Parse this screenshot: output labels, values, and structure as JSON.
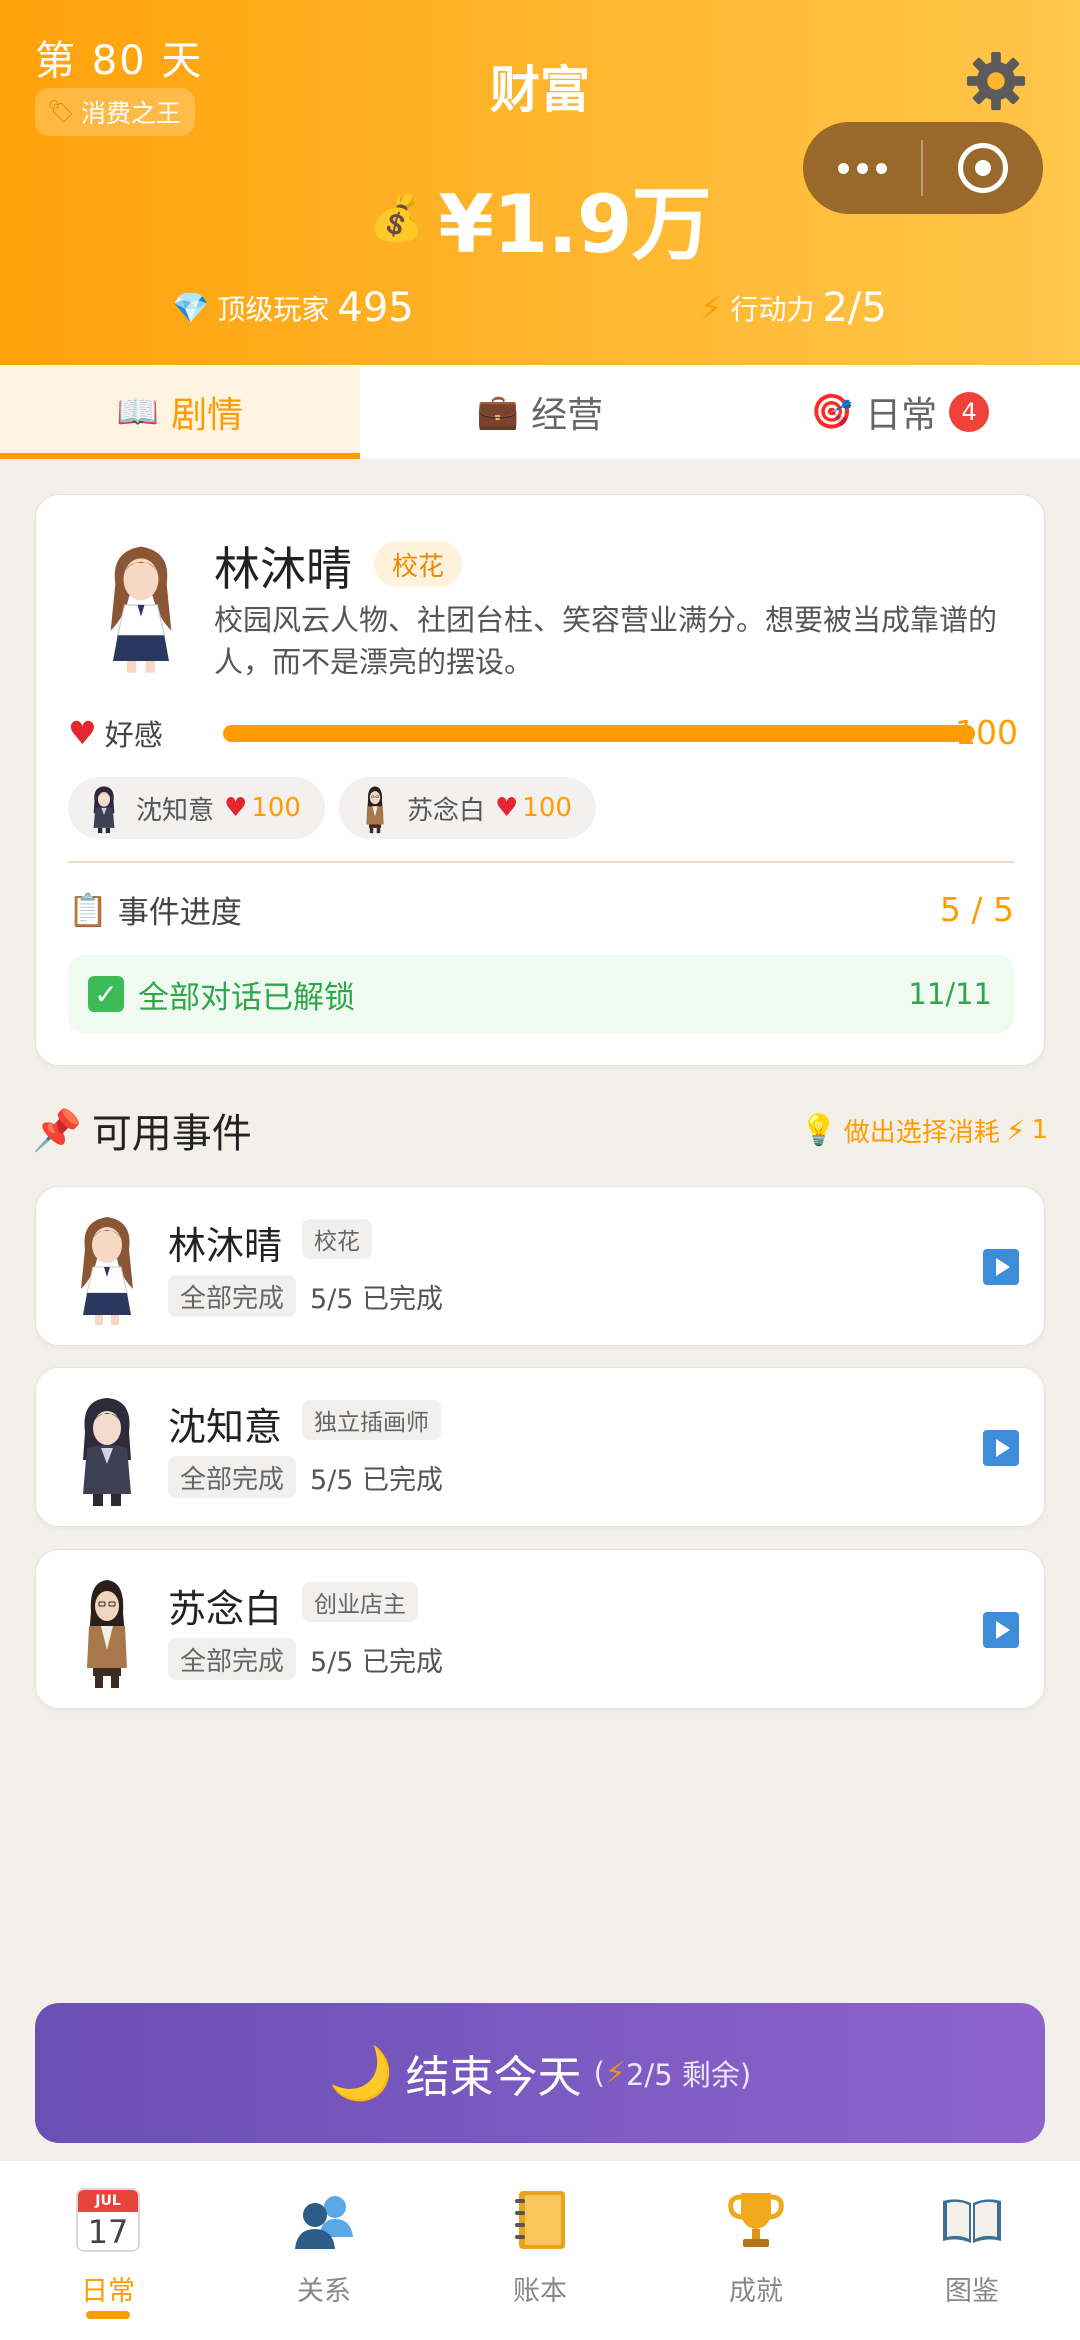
{
  "header": {
    "day": "第 80 天",
    "title_badge": "消费之王",
    "title": "财富",
    "money": "¥1.9万",
    "player_label": "顶级玩家",
    "player_value": "495",
    "energy_label": "行动力",
    "energy_value": "2/5"
  },
  "tabs": [
    {
      "label": "剧情",
      "icon": "book-icon",
      "active": true
    },
    {
      "label": "经营",
      "icon": "briefcase-icon"
    },
    {
      "label": "日常",
      "icon": "target-icon",
      "badge": "4"
    }
  ],
  "character": {
    "name": "林沐晴",
    "tag": "校花",
    "description": "校园风云人物、社团台柱、笑容营业满分。想要被当成靠谱的人，而不是漂亮的摆设。",
    "affection_label": "好感",
    "affection_value": "100",
    "affection_fraction": 1.0,
    "relations": [
      {
        "name": "沈知意",
        "value": "100"
      },
      {
        "name": "苏念白",
        "value": "100"
      }
    ],
    "progress_label": "事件进度",
    "progress_value": "5 / 5",
    "unlock_label": "全部对话已解锁",
    "unlock_count": "11/11"
  },
  "events_section": {
    "title": "可用事件",
    "hint": "做出选择消耗",
    "hint_cost": "1"
  },
  "events": [
    {
      "name": "林沐晴",
      "tag": "校花",
      "status": "全部完成",
      "progress": "5/5 已完成"
    },
    {
      "name": "沈知意",
      "tag": "独立插画师",
      "status": "全部完成",
      "progress": "5/5 已完成"
    },
    {
      "name": "苏念白",
      "tag": "创业店主",
      "status": "全部完成",
      "progress": "5/5 已完成"
    }
  ],
  "end_day": {
    "label": "结束今天",
    "remaining_prefix": "(",
    "remaining_value": "2/5 剩余)"
  },
  "nav": [
    {
      "label": "日常",
      "icon": "calendar-icon",
      "active": true,
      "cal_month": "JUL",
      "cal_day": "17"
    },
    {
      "label": "关系",
      "icon": "people-icon"
    },
    {
      "label": "账本",
      "icon": "notebook-icon"
    },
    {
      "label": "成就",
      "icon": "trophy-icon"
    },
    {
      "label": "图鉴",
      "icon": "open-book-icon"
    }
  ],
  "colors": {
    "accent": "#ff9c00",
    "header_start": "#ffa20a",
    "header_end": "#ffc64a",
    "button_purple": "#7b5ac2",
    "success_green": "#2fa64a",
    "heart_red": "#e3262f"
  }
}
